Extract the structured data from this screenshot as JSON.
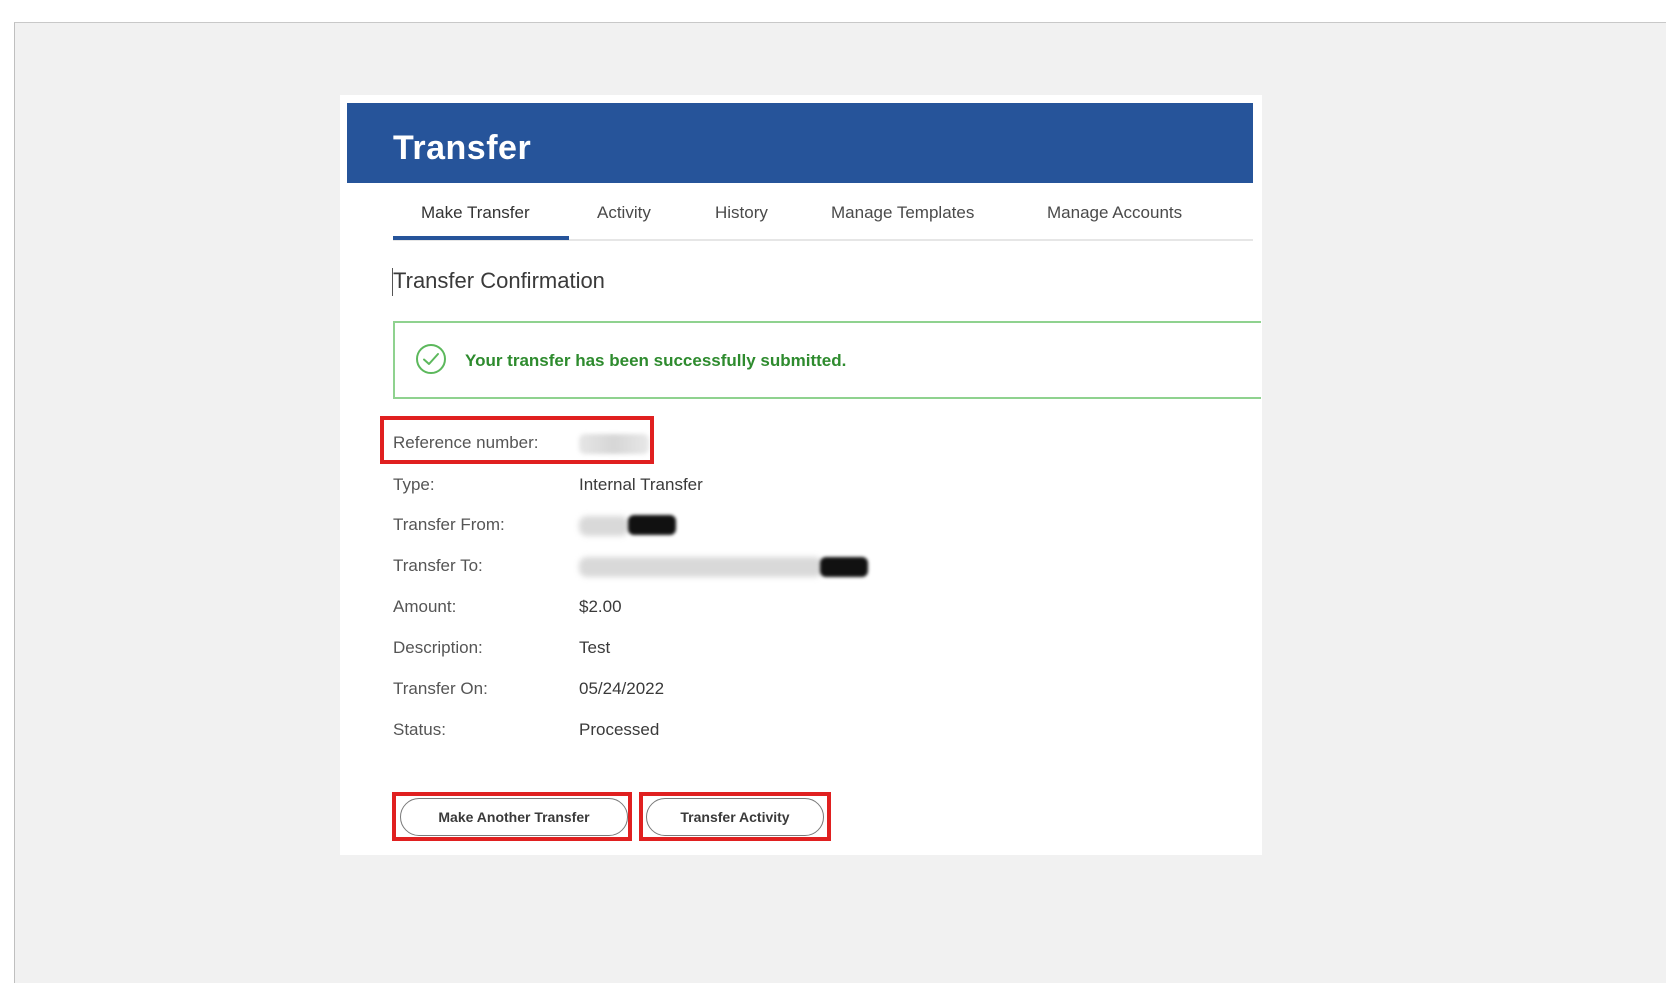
{
  "header": {
    "title": "Transfer"
  },
  "tabs": [
    {
      "label": "Make Transfer",
      "active": true
    },
    {
      "label": "Activity"
    },
    {
      "label": "History"
    },
    {
      "label": "Manage Templates"
    },
    {
      "label": "Manage Accounts"
    }
  ],
  "confirmation": {
    "title": "Transfer Confirmation",
    "success_message": "Your transfer has been successfully submitted."
  },
  "details": {
    "reference_label": "Reference number:",
    "rows": [
      {
        "label": "Type:",
        "value": "Internal Transfer"
      },
      {
        "label": "Transfer From:",
        "value": ""
      },
      {
        "label": "Transfer To:",
        "value": ""
      },
      {
        "label": "Amount:",
        "value": "$2.00"
      },
      {
        "label": "Description:",
        "value": "Test"
      },
      {
        "label": "Transfer On:",
        "value": "05/24/2022"
      },
      {
        "label": "Status:",
        "value": "Processed"
      }
    ]
  },
  "buttons": {
    "make_another": "Make Another Transfer",
    "transfer_activity": "Transfer Activity"
  },
  "colors": {
    "header_blue": "#26549a",
    "success_green": "#2e8b2e",
    "highlight_red": "#e02020"
  }
}
